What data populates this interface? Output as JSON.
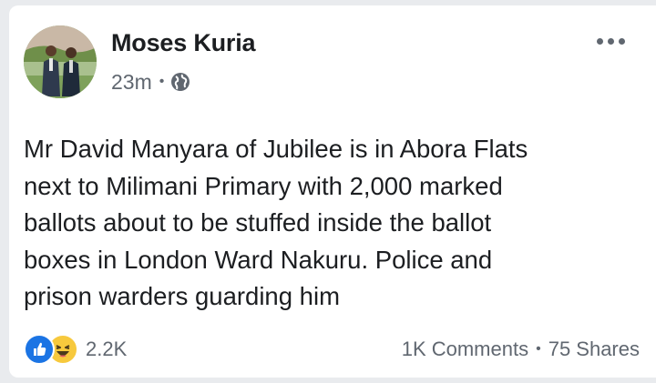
{
  "post": {
    "author": "Moses Kuria",
    "time": "23m",
    "privacy_icon": "globe-icon",
    "menu_icon": "more-options-icon",
    "text": "Mr David Manyara of Jubilee is in Abora Flats\nnext to Milimani Primary with 2,000 marked\nballots about to be stuffed inside the ballot\nboxes in London Ward Nakuru. Police and\nprison warders guarding him",
    "reactions": {
      "icons": [
        "like-icon",
        "haha-icon"
      ],
      "count": "2.2K"
    },
    "comments": "1K Comments",
    "shares": "75 Shares"
  },
  "colors": {
    "like": "#1b74e4",
    "haha": "#f7c93d",
    "text": "#1c1e21",
    "secondary": "#606770"
  }
}
